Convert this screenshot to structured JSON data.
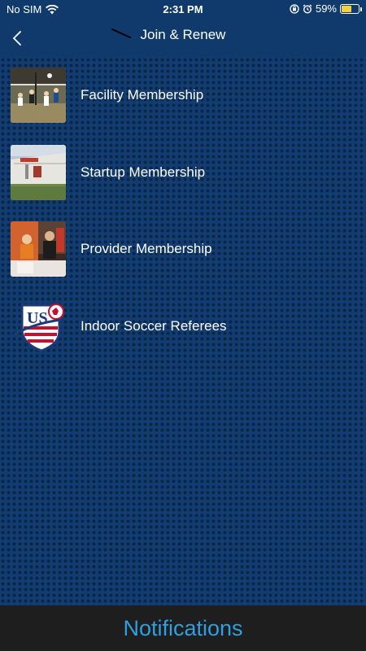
{
  "status_bar": {
    "carrier": "No SIM",
    "time": "2:31 PM",
    "battery_percent": "59%",
    "battery_level": 0.59
  },
  "header": {
    "title": "Join & Renew"
  },
  "items": [
    {
      "label": "Facility Membership",
      "thumb": "volleyball-photo"
    },
    {
      "label": "Startup Membership",
      "thumb": "building-photo"
    },
    {
      "label": "Provider Membership",
      "thumb": "booth-photo"
    },
    {
      "label": "Indoor Soccer Referees",
      "thumb": "us-soccer-logo"
    }
  ],
  "footer": {
    "notifications_label": "Notifications"
  },
  "colors": {
    "header_bg": "#0f3a6b",
    "footer_bg": "#1e1e1e",
    "footer_text": "#2f9fe0"
  }
}
